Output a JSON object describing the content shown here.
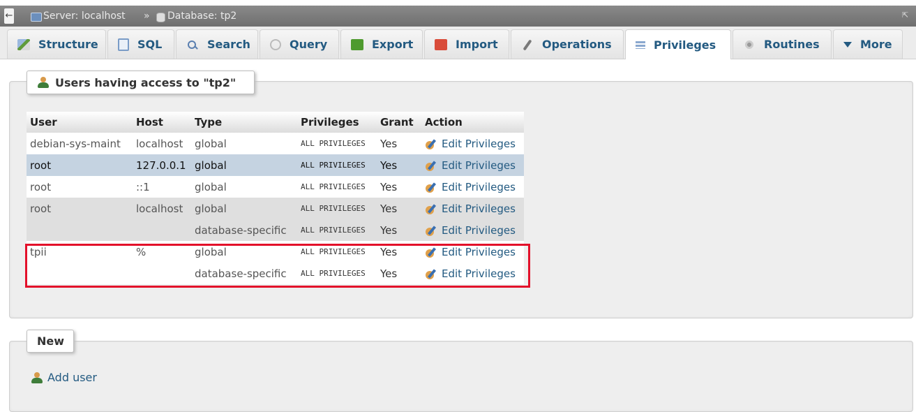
{
  "breadcrumb": {
    "server": "Server: localhost",
    "separator": "»",
    "database": "Database: tp2"
  },
  "tabs": [
    {
      "label": "Structure",
      "icon": "structure-icon"
    },
    {
      "label": "SQL",
      "icon": "sql-icon"
    },
    {
      "label": "Search",
      "icon": "search-icon"
    },
    {
      "label": "Query",
      "icon": "query-icon"
    },
    {
      "label": "Export",
      "icon": "export-icon"
    },
    {
      "label": "Import",
      "icon": "import-icon"
    },
    {
      "label": "Operations",
      "icon": "operations-icon"
    },
    {
      "label": "Privileges",
      "icon": "privileges-icon",
      "active": true
    },
    {
      "label": "Routines",
      "icon": "routines-icon"
    },
    {
      "label": "More",
      "icon": "chevron-down-icon"
    }
  ],
  "users_section": {
    "legend": "Users having access to \"tp2\"",
    "columns": [
      "User",
      "Host",
      "Type",
      "Privileges",
      "Grant",
      "Action"
    ],
    "rows": [
      {
        "user": "debian-sys-maint",
        "host": "localhost",
        "type": "global",
        "privileges": "ALL PRIVILEGES",
        "grant": "Yes",
        "action": "Edit Privileges"
      },
      {
        "user": "root",
        "host": "127.0.0.1",
        "type": "global",
        "privileges": "ALL PRIVILEGES",
        "grant": "Yes",
        "action": "Edit Privileges"
      },
      {
        "user": "root",
        "host": "::1",
        "type": "global",
        "privileges": "ALL PRIVILEGES",
        "grant": "Yes",
        "action": "Edit Privileges"
      },
      {
        "user": "root",
        "host": "localhost",
        "type": "global",
        "privileges": "ALL PRIVILEGES",
        "grant": "Yes",
        "action": "Edit Privileges"
      },
      {
        "user": "",
        "host": "",
        "type": "database-specific",
        "privileges": "ALL PRIVILEGES",
        "grant": "Yes",
        "action": "Edit Privileges"
      },
      {
        "user": "tpii",
        "host": "%",
        "type": "global",
        "privileges": "ALL PRIVILEGES",
        "grant": "Yes",
        "action": "Edit Privileges"
      },
      {
        "user": "",
        "host": "",
        "type": "database-specific",
        "privileges": "ALL PRIVILEGES",
        "grant": "Yes",
        "action": "Edit Privileges"
      }
    ]
  },
  "new_section": {
    "legend": "New",
    "add_user": "Add user"
  },
  "colors": {
    "link": "#235a81",
    "highlight_box": "#e3102a",
    "selected_row": "#c5d3e1"
  }
}
